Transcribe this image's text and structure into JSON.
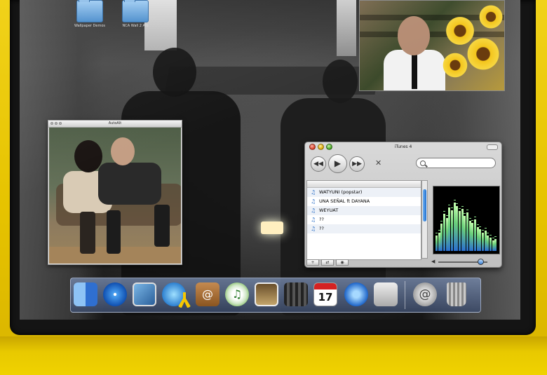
{
  "desktop": {
    "icons": [
      {
        "label": "Wallpaper Demos",
        "icon": "folder-icon"
      },
      {
        "label": "NCA Wall 2 Alb",
        "icon": "folder-icon"
      }
    ]
  },
  "photo_window": {
    "title": "AutoAlt"
  },
  "itunes": {
    "title": "iTunes 4",
    "controls": {
      "prev_icon": "◀◀",
      "play_icon": "▶",
      "next_icon": "▶▶",
      "close_glyph": "✕"
    },
    "songs": [
      {
        "title": "WATYUNI (popstar)"
      },
      {
        "title": "UNA SEÑAL ft DAYANA"
      },
      {
        "title": "WEYUAT"
      },
      {
        "title": "??"
      },
      {
        "title": "??"
      }
    ],
    "bottom_buttons": [
      "+",
      "⇄",
      "◉"
    ],
    "volume_level": 0.85,
    "visualizer_levels": [
      0.25,
      0.3,
      0.45,
      0.62,
      0.55,
      0.72,
      0.68,
      0.8,
      0.74,
      0.66,
      0.7,
      0.58,
      0.64,
      0.5,
      0.46,
      0.52,
      0.4,
      0.36,
      0.3,
      0.34,
      0.26,
      0.22,
      0.18,
      0.2
    ]
  },
  "dock": {
    "items": [
      {
        "name": "finder-icon"
      },
      {
        "name": "safari-icon"
      },
      {
        "name": "preview-icon"
      },
      {
        "name": "ichat-icon"
      },
      {
        "name": "aim-icon"
      },
      {
        "name": "address-book-icon",
        "glyph": "@"
      },
      {
        "name": "itunes-icon",
        "glyph": "♫"
      },
      {
        "name": "iphoto-icon"
      },
      {
        "name": "imovie-icon"
      },
      {
        "name": "ical-icon",
        "day": "17"
      },
      {
        "name": "quicktime-icon"
      },
      {
        "name": "apple-icon",
        "glyph": ""
      },
      {
        "name": "mail-icon",
        "glyph": "@"
      },
      {
        "name": "trash-icon"
      }
    ]
  },
  "colors": {
    "frame": "#e6c300",
    "bezel": "#141414",
    "dock": "#4b5f86",
    "accent_blue": "#2b6fc7"
  }
}
